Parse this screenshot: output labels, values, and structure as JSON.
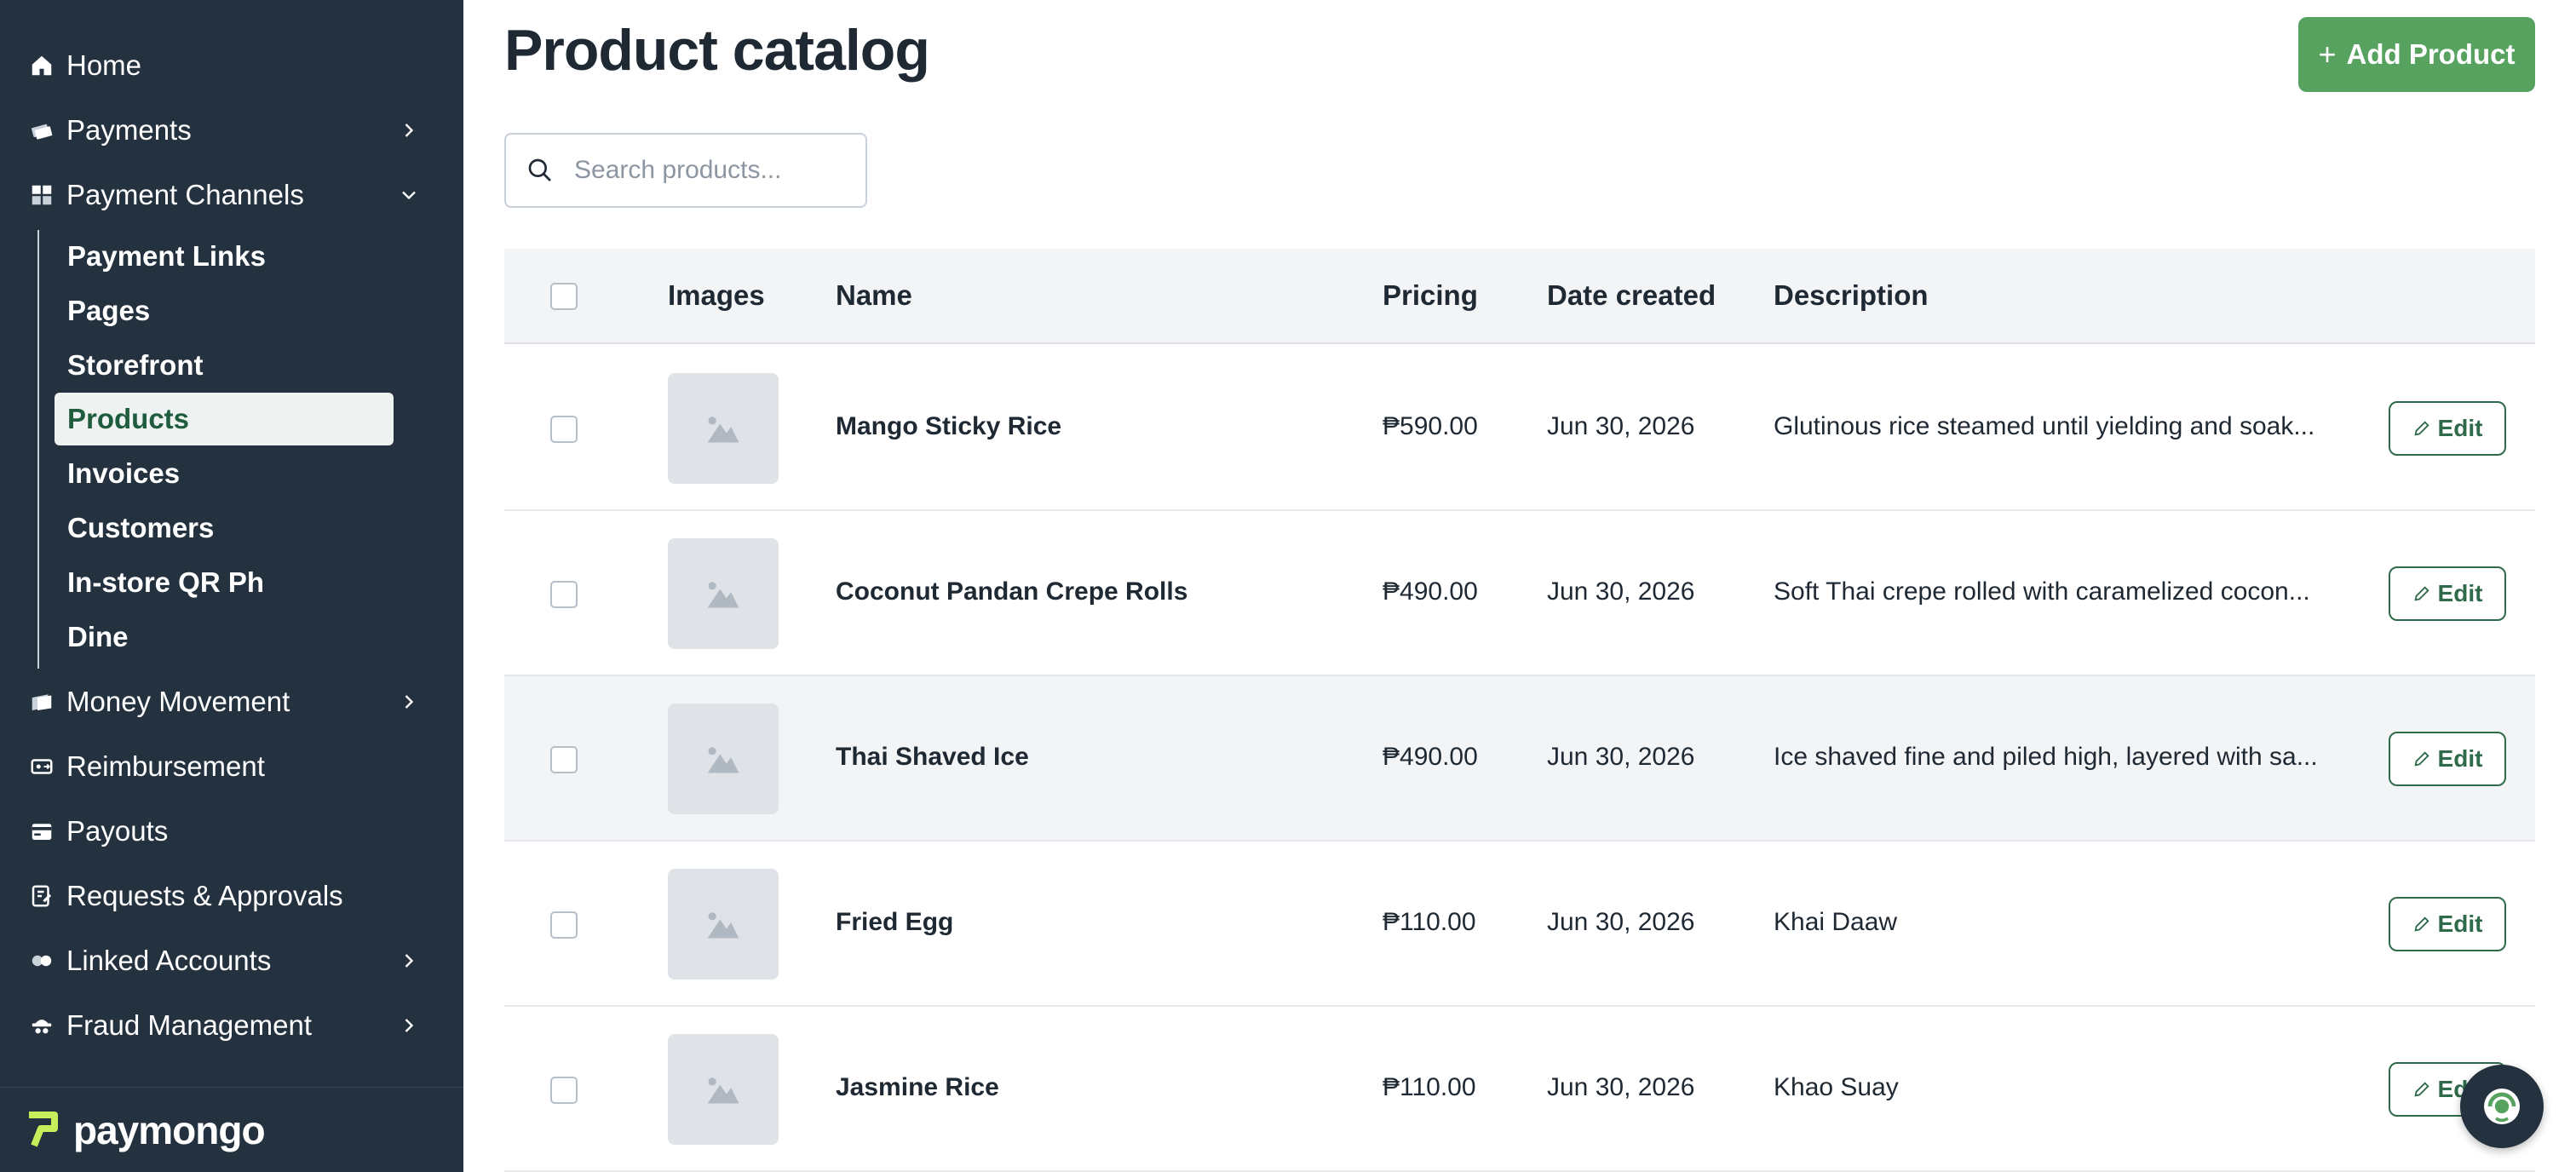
{
  "sidebar": {
    "items_top": [
      {
        "label": "Home",
        "icon": "home-icon"
      },
      {
        "label": "Payments",
        "icon": "payments-icon"
      },
      {
        "label": "Payment Channels",
        "icon": "payment-channels-icon"
      }
    ],
    "sub_items": [
      {
        "label": "Payment Links"
      },
      {
        "label": "Pages"
      },
      {
        "label": "Storefront"
      },
      {
        "label": "Products",
        "active": true
      },
      {
        "label": "Invoices"
      },
      {
        "label": "Customers"
      },
      {
        "label": "In-store QR Ph"
      },
      {
        "label": "Dine"
      }
    ],
    "items_bottom": [
      {
        "label": "Money Movement",
        "icon": "money-movement-icon"
      },
      {
        "label": "Reimbursement",
        "icon": "reimbursement-icon"
      },
      {
        "label": "Payouts",
        "icon": "payouts-icon"
      },
      {
        "label": "Requests & Approvals",
        "icon": "requests-icon"
      },
      {
        "label": "Linked Accounts",
        "icon": "linked-accounts-icon"
      },
      {
        "label": "Fraud Management",
        "icon": "fraud-icon"
      }
    ],
    "brand": "paymongo"
  },
  "header": {
    "title": "Product catalog",
    "add_button": "Add Product"
  },
  "search": {
    "placeholder": "Search products..."
  },
  "table": {
    "columns": [
      "Images",
      "Name",
      "Pricing",
      "Date created",
      "Description"
    ],
    "edit_label": "Edit",
    "rows": [
      {
        "name": "Mango Sticky Rice",
        "price": "₱590.00",
        "date": "Jun 30, 2026",
        "description": "Glutinous rice steamed until yielding and soak..."
      },
      {
        "name": "Coconut Pandan Crepe Rolls",
        "price": "₱490.00",
        "date": "Jun 30, 2026",
        "description": "Soft Thai crepe rolled with caramelized cocon..."
      },
      {
        "name": "Thai Shaved Ice",
        "price": "₱490.00",
        "date": "Jun 30, 2026",
        "description": "Ice shaved fine and piled high, layered with sa..."
      },
      {
        "name": "Fried Egg",
        "price": "₱110.00",
        "date": "Jun 30, 2026",
        "description": "Khai Daaw"
      },
      {
        "name": "Jasmine Rice",
        "price": "₱110.00",
        "date": "Jun 30, 2026",
        "description": "Khao Suay"
      }
    ]
  },
  "colors": {
    "sidebar_bg": "#24313f",
    "accent_green": "#56a25e",
    "edit_green": "#2f6b4b"
  }
}
